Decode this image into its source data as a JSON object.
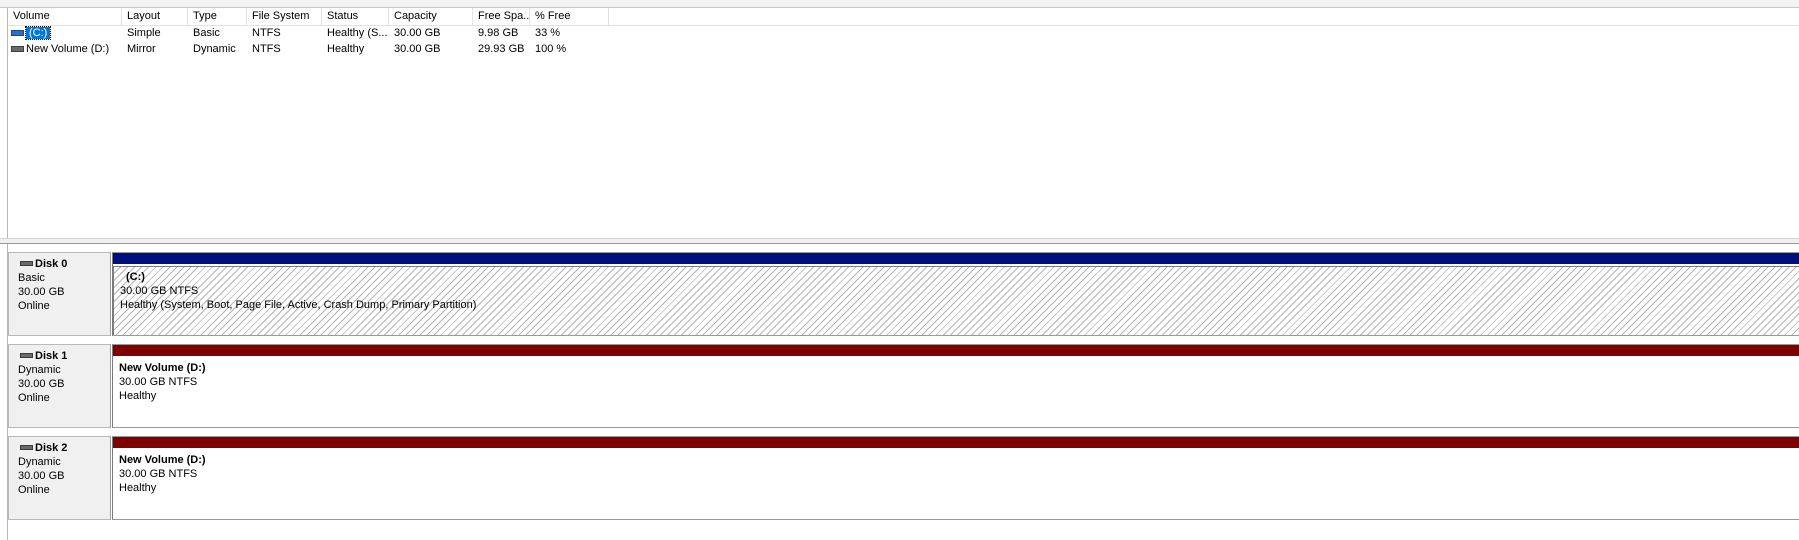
{
  "columns": [
    "Volume",
    "Layout",
    "Type",
    "File System",
    "Status",
    "Capacity",
    "Free Spa...",
    "% Free"
  ],
  "volumes": [
    {
      "name": "(C:)",
      "layout": "Simple",
      "type": "Basic",
      "fs": "NTFS",
      "status": "Healthy (S...",
      "capacity": "30.00 GB",
      "free": "9.98 GB",
      "pct": "33 %",
      "selected": true,
      "icon": "volume-icon-blue"
    },
    {
      "name": "New Volume (D:)",
      "layout": "Mirror",
      "type": "Dynamic",
      "fs": "NTFS",
      "status": "Healthy",
      "capacity": "30.00 GB",
      "free": "29.93 GB",
      "pct": "100 %",
      "selected": false,
      "icon": "volume-icon"
    }
  ],
  "disks": [
    {
      "name": "Disk 0",
      "type": "Basic",
      "size": "30.00 GB",
      "state": "Online",
      "partition": {
        "title": "(C:)",
        "size_fs": "30.00 GB NTFS",
        "status": "Healthy (System, Boot, Page File, Active, Crash Dump, Primary Partition)"
      }
    },
    {
      "name": "Disk 1",
      "type": "Dynamic",
      "size": "30.00 GB",
      "state": "Online",
      "partition": {
        "title": "New Volume  (D:)",
        "size_fs": "30.00 GB NTFS",
        "status": "Healthy"
      }
    },
    {
      "name": "Disk 2",
      "type": "Dynamic",
      "size": "30.00 GB",
      "state": "Online",
      "partition": {
        "title": "New Volume  (D:)",
        "size_fs": "30.00 GB NTFS",
        "status": "Healthy"
      }
    }
  ],
  "colors": {
    "basic_bar": "#000f80",
    "dynamic_bar": "#800000",
    "selection": "#0078d7"
  }
}
